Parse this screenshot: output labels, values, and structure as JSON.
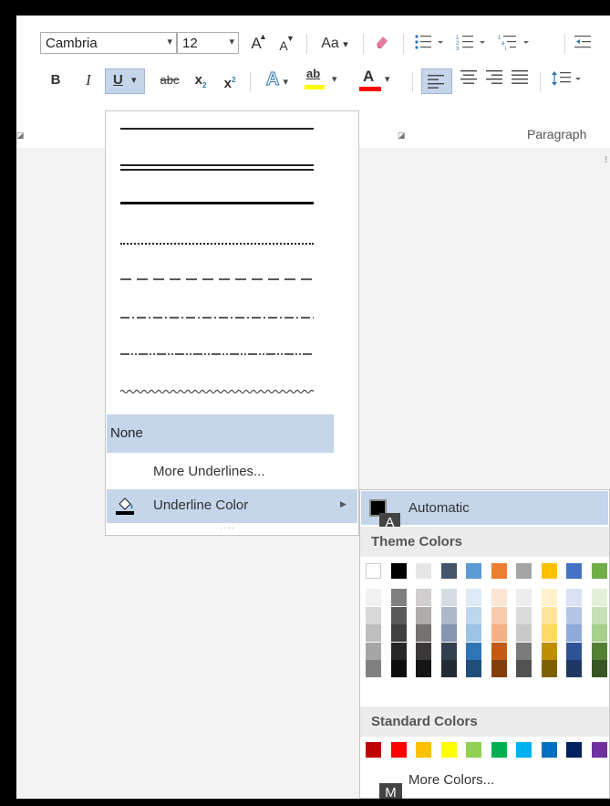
{
  "font": {
    "name": "Cambria",
    "size": "12"
  },
  "toolbar": {
    "grow_font": "A",
    "shrink_font": "A",
    "change_case": "Aa",
    "change_case_arrow": "▾",
    "bold": "B",
    "italic": "I",
    "underline": "U",
    "underline_arrow": "▾",
    "strikethrough": "abc",
    "subscript": "x",
    "subscript_mark": "2",
    "superscript": "x",
    "superscript_mark": "2",
    "text_effects": "A",
    "highlight": "ab",
    "font_color": "A",
    "dropdown_arrow": "▾"
  },
  "ribbon": {
    "paragraph_group_label": "Paragraph"
  },
  "underline_menu": {
    "styles": [
      "single",
      "double",
      "thick",
      "dotted",
      "dashed",
      "dash-dot",
      "dash-dot-dot",
      "wave"
    ],
    "none_label": "None",
    "more_underlines_label": "More Underlines...",
    "underline_color_label": "Underline Color",
    "submenu_arrow": "▶",
    "resize_grip": "····"
  },
  "color_menu": {
    "automatic_label": "Automatic",
    "automatic_keytip": "A",
    "automatic_color": "#000000",
    "theme_colors_label": "Theme Colors",
    "theme_top_row": [
      "#FFFFFF",
      "#000000",
      "#E7E6E6",
      "#44546A",
      "#5B9BD5",
      "#ED7D31",
      "#A5A5A5",
      "#FFC000",
      "#4472C4",
      "#70AD47"
    ],
    "theme_shades": [
      [
        "#F2F2F2",
        "#D9D9D9",
        "#BFBFBF",
        "#A6A6A6",
        "#808080"
      ],
      [
        "#808080",
        "#595959",
        "#404040",
        "#262626",
        "#0D0D0D"
      ],
      [
        "#D0CECE",
        "#AEABAB",
        "#757171",
        "#3A3838",
        "#171616"
      ],
      [
        "#D6DCE4",
        "#ADB9CA",
        "#8496B0",
        "#323F4F",
        "#222A35"
      ],
      [
        "#DEEBF6",
        "#BDD7EE",
        "#9DC3E6",
        "#2E75B5",
        "#1F4E79"
      ],
      [
        "#FBE5D5",
        "#F7CBAC",
        "#F4B183",
        "#C55A11",
        "#843C0B"
      ],
      [
        "#EDEDED",
        "#DBDBDB",
        "#C9C9C9",
        "#7B7B7B",
        "#525252"
      ],
      [
        "#FFF2CC",
        "#FEE599",
        "#FFD965",
        "#BF8F00",
        "#7F6000"
      ],
      [
        "#D9E2F3",
        "#B4C6E7",
        "#8EAADB",
        "#2F5496",
        "#1F3864"
      ],
      [
        "#E2EFD9",
        "#C5E0B3",
        "#A8D08D",
        "#538135",
        "#375623"
      ]
    ],
    "standard_colors_label": "Standard Colors",
    "standard_colors": [
      "#C00000",
      "#FF0000",
      "#FFC000",
      "#FFFF00",
      "#92D050",
      "#00B050",
      "#00B0F0",
      "#0070C0",
      "#002060",
      "#7030A0"
    ],
    "more_colors_label": "More Colors...",
    "more_colors_keytip": "M"
  }
}
